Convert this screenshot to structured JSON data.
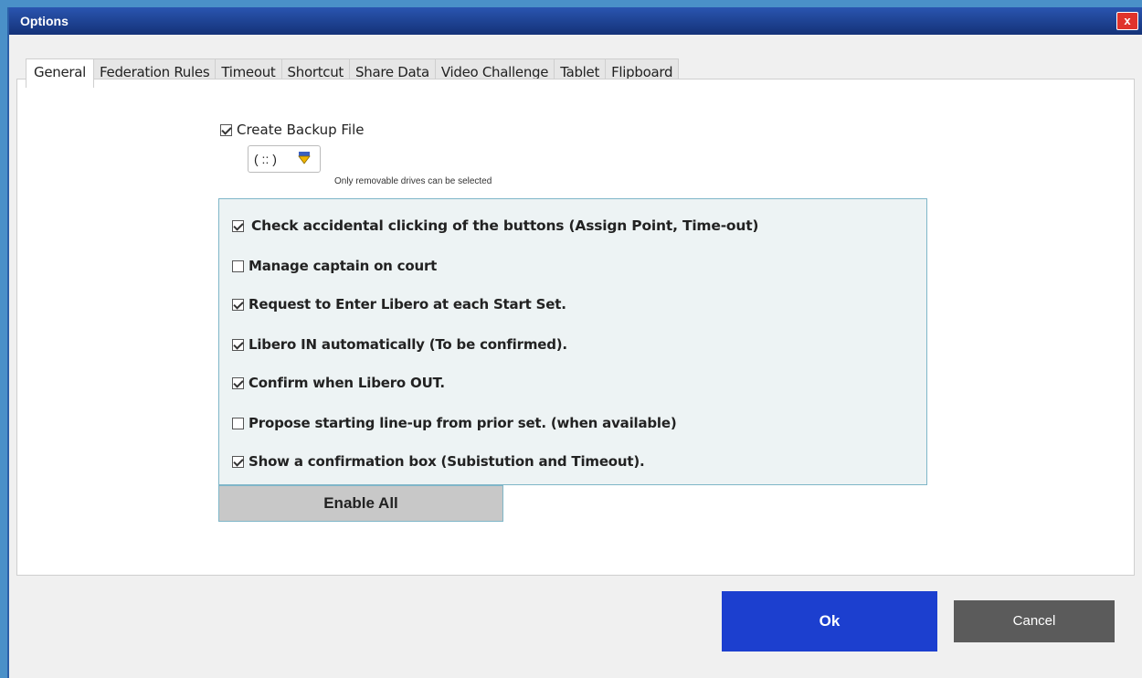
{
  "window": {
    "title": "Options",
    "close_label": "x"
  },
  "tabs": [
    {
      "label": "General",
      "active": true
    },
    {
      "label": "Federation Rules",
      "active": false
    },
    {
      "label": "Timeout",
      "active": false
    },
    {
      "label": "Shortcut",
      "active": false
    },
    {
      "label": "Share Data",
      "active": false
    },
    {
      "label": "Video Challenge",
      "active": false
    },
    {
      "label": "Tablet",
      "active": false
    },
    {
      "label": "Flipboard",
      "active": false
    }
  ],
  "backup": {
    "label": "Create Backup File",
    "checked": true,
    "drive_value": "( :: )",
    "hint": "Only removable drives can be selected"
  },
  "options": [
    {
      "label": "Check accidental clicking of the buttons (Assign Point, Time-out)",
      "checked": true
    },
    {
      "label": "Manage captain on court",
      "checked": false
    },
    {
      "label": "Request to Enter Libero at each Start Set.",
      "checked": true
    },
    {
      "label": "Libero IN automatically (To be confirmed).",
      "checked": true
    },
    {
      "label": "Confirm when Libero OUT.",
      "checked": true
    },
    {
      "label": "Propose starting line-up from prior set. (when available)",
      "checked": false
    },
    {
      "label": "Show a confirmation box (Subistution and Timeout).",
      "checked": true
    }
  ],
  "buttons": {
    "enable_all": "Enable All",
    "ok": "Ok",
    "cancel": "Cancel"
  },
  "colors": {
    "titlebar": "#1e3f8f",
    "ok": "#1c3fcf",
    "cancel": "#5b5b5b",
    "close": "#e0332b"
  }
}
